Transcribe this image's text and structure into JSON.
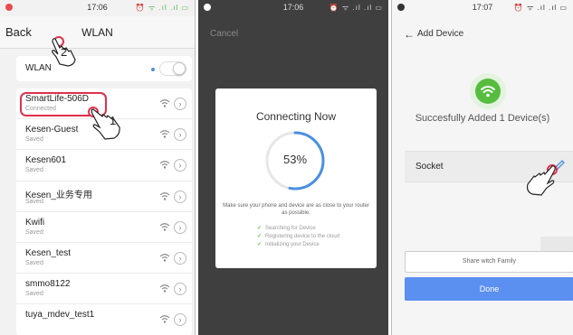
{
  "panel1": {
    "status": {
      "time": "17:06",
      "icons": "⏰ ᯤ .ıl .ıl ▭"
    },
    "nav": {
      "back": "Back",
      "title": "WLAN"
    },
    "wlan_label": "WLAN",
    "networks": [
      {
        "name": "SmartLife-506D",
        "status": "Connected"
      },
      {
        "name": "Kesen-Guest",
        "status": "Saved"
      },
      {
        "name": "Kesen601",
        "status": "Saved"
      },
      {
        "name": "Kesen_业务专用",
        "status": "Saved"
      },
      {
        "name": "Kwifi",
        "status": "Saved"
      },
      {
        "name": "Kesen_test",
        "status": "Saved"
      },
      {
        "name": "smmo8122",
        "status": "Saved"
      },
      {
        "name": "tuya_mdev_test1",
        "status": ""
      }
    ],
    "info_glyph": "›",
    "step_markers": {
      "back": "2",
      "network": "1"
    }
  },
  "panel2": {
    "status": {
      "time": "17:06",
      "icons": "⏰ ᯤ .ıl .ıl ▭"
    },
    "cancel": "Cancel",
    "modal": {
      "title": "Connecting Now",
      "progress_text": "53%",
      "progress": 0.53,
      "hint": "Make sure your phone and device are as close to your router as possible.",
      "steps": [
        "Searching for Device",
        "Registering device to the cloud",
        "Initializing your Device"
      ],
      "check_glyph": "✔"
    }
  },
  "panel3": {
    "status": {
      "time": "17:07",
      "icons": "⏰ ᯤ .ıl .ıl ▭"
    },
    "back_glyph": "←",
    "title": "Add Device",
    "success_text": "Succesfully Added 1 Device(s)",
    "device_name": "Socket",
    "share_button": "Share witch Family",
    "done_button": "Done"
  },
  "colors": {
    "highlight_red": "#e0304a",
    "progress_blue": "#4a90e2",
    "success_green": "#56bd3f",
    "done_blue": "#5b8ff0"
  }
}
